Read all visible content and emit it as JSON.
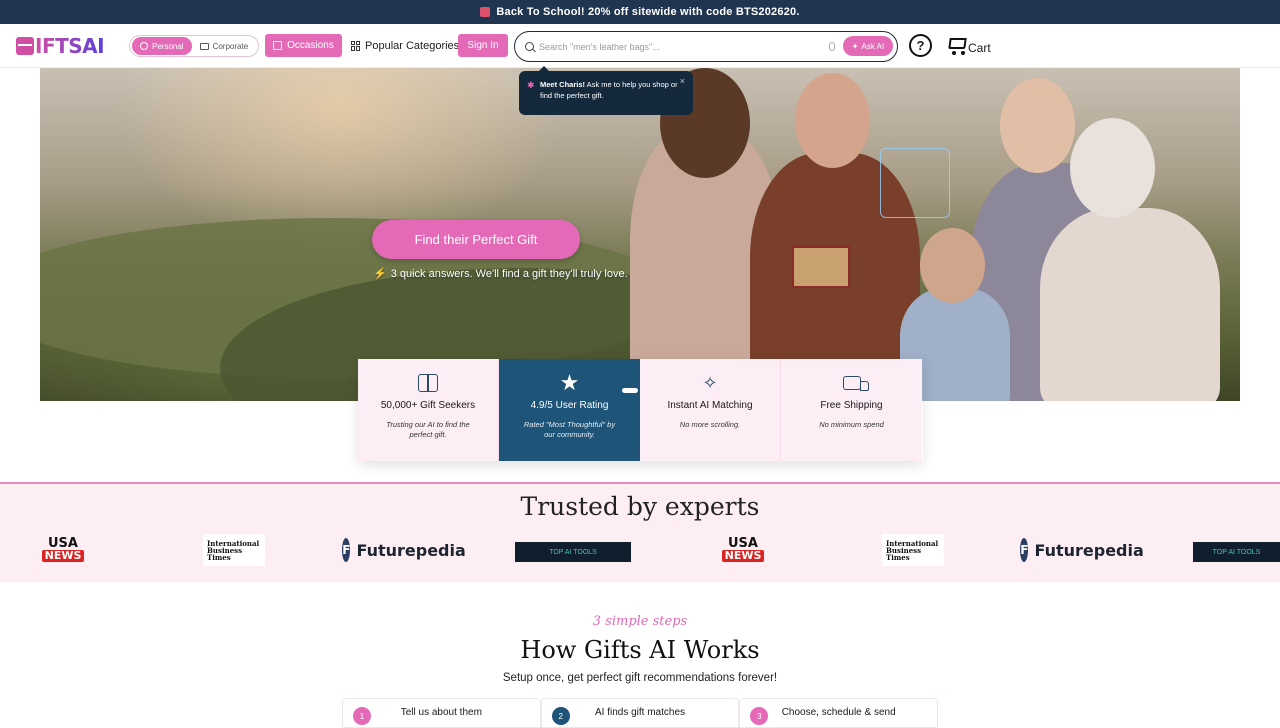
{
  "promo": {
    "text": "Back To School! 20% off sitewide with code BTS202620."
  },
  "header": {
    "logo_text": "IFTSAI",
    "toggle": {
      "personal": "Personal",
      "corporate": "Corporate"
    },
    "occasions": "Occasions",
    "popular_categories": "Popular Categories",
    "sign_in": "Sign In",
    "search_placeholder": "Search \"men's leather bags\"...",
    "ask_ai": "Ask AI",
    "help": "?",
    "cart": "Cart"
  },
  "tooltip": {
    "title": "Meet Charis!",
    "text": " Ask me to help you shop or find the perfect gift.",
    "close": "×"
  },
  "hero": {
    "cta": "Find their Perfect Gift",
    "subtext": "3 quick answers. We'll find a gift they'll truly love."
  },
  "stats": [
    {
      "title": "50,000+ Gift Seekers",
      "desc": "Trusting our AI to find the perfect gift.",
      "icon": "gift-star-icon"
    },
    {
      "title": "4.9/5 User Rating",
      "desc": "Rated \"Most Thoughtful\" by our community.",
      "icon": "star-icon"
    },
    {
      "title": "Instant AI Matching",
      "desc": "No more scrolling.",
      "icon": "sparkle-icon"
    },
    {
      "title": "Free Shipping",
      "desc": "No minimum spend",
      "icon": "truck-icon"
    }
  ],
  "trusted": {
    "heading": "Trusted by experts",
    "logos": {
      "usa": "USA",
      "news": "NEWS",
      "ibt1": "International",
      "ibt2": "Business",
      "ibt3": "Times",
      "futurepedia": "Futurepedia",
      "topai": "TOP AI TOOLS"
    }
  },
  "how": {
    "kicker": "3 simple steps",
    "title": "How Gifts AI Works",
    "subtitle": "Setup once, get perfect gift recommendations forever!",
    "steps": [
      {
        "num": "1",
        "label": "Tell us about them"
      },
      {
        "num": "2",
        "label": "AI finds gift matches"
      },
      {
        "num": "3",
        "label": "Choose, schedule & send"
      }
    ]
  },
  "colors": {
    "accent": "#e46ab8",
    "navy": "#1d5478",
    "promo_bg": "#1f3550"
  }
}
